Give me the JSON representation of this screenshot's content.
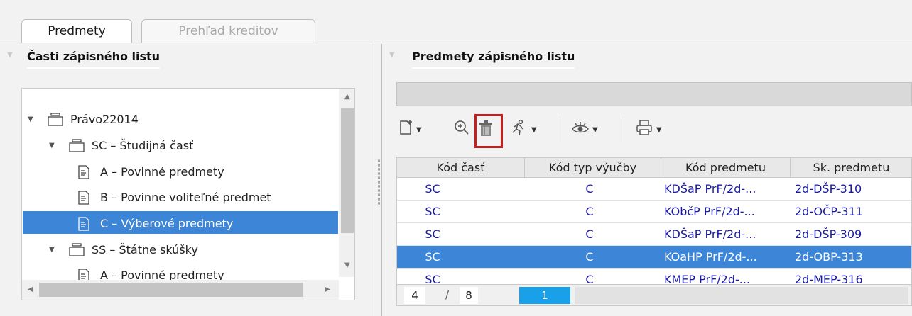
{
  "tabs": [
    {
      "label": "Predmety",
      "active": true
    },
    {
      "label": "Prehľad kreditov",
      "active": false
    }
  ],
  "left_panel": {
    "title": "Časti zápisného listu",
    "tree": [
      {
        "label": "Právo22014",
        "level": 0,
        "icon": "folder-stack-icon",
        "expanded": true,
        "selected": false
      },
      {
        "label": "SC – Študijná časť",
        "level": 1,
        "icon": "folder-stack-icon",
        "expanded": true,
        "selected": false
      },
      {
        "label": "A – Povinné predmety",
        "level": 2,
        "icon": "document-icon",
        "selected": false
      },
      {
        "label": "B – Povinne voliteľné predmet",
        "level": 2,
        "icon": "document-icon",
        "selected": false
      },
      {
        "label": "C – Výberové predmety",
        "level": 2,
        "icon": "document-icon",
        "selected": true
      },
      {
        "label": "SS – Štátne skúšky",
        "level": 1,
        "icon": "folder-stack-icon",
        "expanded": true,
        "selected": false
      },
      {
        "label": "A – Povinné predmety",
        "level": 2,
        "icon": "document-icon",
        "selected": false
      }
    ]
  },
  "right_panel": {
    "title": "Predmety zápisného listu",
    "toolbar": [
      {
        "icon": "add-document-icon",
        "dropdown": true
      },
      {
        "icon": "zoom-in-icon",
        "dropdown": false
      },
      {
        "icon": "trash-icon",
        "dropdown": false,
        "highlighted": true
      },
      {
        "icon": "run-icon",
        "dropdown": true
      },
      {
        "icon": "eye-icon",
        "dropdown": true
      },
      {
        "icon": "print-icon",
        "dropdown": true
      }
    ],
    "columns": [
      "Kód časť",
      "Kód typ výučby",
      "Kód predmetu",
      "Sk. predmetu"
    ],
    "rows": [
      {
        "cells": [
          "SC",
          "C",
          "KDŠaP PrF/2d-...",
          "2d-DŠP-310"
        ],
        "selected": false
      },
      {
        "cells": [
          "SC",
          "C",
          "KObčP PrF/2d-...",
          "2d-OČP-311"
        ],
        "selected": false
      },
      {
        "cells": [
          "SC",
          "C",
          "KDŠaP PrF/2d-...",
          "2d-DŠP-309"
        ],
        "selected": false
      },
      {
        "cells": [
          "SC",
          "C",
          "KOaHP PrF/2d-...",
          "2d-OBP-313"
        ],
        "selected": true
      },
      {
        "cells": [
          "SC",
          "C",
          "KMEP PrF/2d-...",
          "2d-MEP-316"
        ],
        "selected": false
      }
    ],
    "pager": {
      "current": "4",
      "separator": "/",
      "total": "8",
      "page": "1"
    }
  },
  "colors": {
    "selection": "#3d85d6",
    "highlight_border": "#c42020",
    "code_text": "#1a1aa0"
  }
}
